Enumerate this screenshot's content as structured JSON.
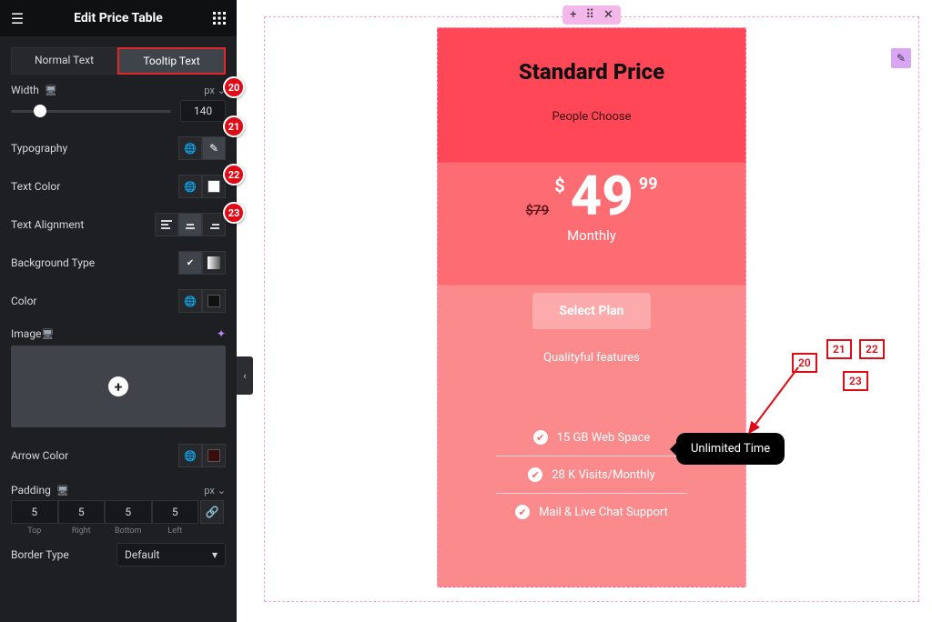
{
  "panel": {
    "title": "Edit Price Table",
    "tabs": {
      "normal": "Normal Text",
      "tooltip": "Tooltip Text"
    },
    "width": {
      "label": "Width",
      "unit": "px",
      "value": "140"
    },
    "typography": {
      "label": "Typography"
    },
    "text_color": {
      "label": "Text Color"
    },
    "text_align": {
      "label": "Text Alignment"
    },
    "bg_type": {
      "label": "Background Type"
    },
    "color": {
      "label": "Color"
    },
    "image": {
      "label": "Image"
    },
    "arrow_color": {
      "label": "Arrow Color"
    },
    "padding": {
      "label": "Padding",
      "unit": "px",
      "top": "5",
      "right": "5",
      "bottom": "5",
      "left": "5",
      "lbl_top": "Top",
      "lbl_right": "Right",
      "lbl_bottom": "Bottom",
      "lbl_left": "Left"
    },
    "border_type": {
      "label": "Border Type",
      "value": "Default"
    }
  },
  "bubbles": {
    "b20": "20",
    "b21": "21",
    "b22": "22",
    "b23": "23"
  },
  "canvas": {
    "card": {
      "title": "Standard Price",
      "subtitle": "People Choose",
      "old_price": "$79",
      "currency": "$",
      "price": "49",
      "cents": "99",
      "period": "Monthly",
      "button": "Select Plan",
      "quality": "Qualityful features",
      "feat1": "15 GB Web Space",
      "feat2": "28 K Visits/Monthly",
      "feat3": "Mail & Live Chat Support"
    },
    "tooltip": "Unlimited Time"
  }
}
